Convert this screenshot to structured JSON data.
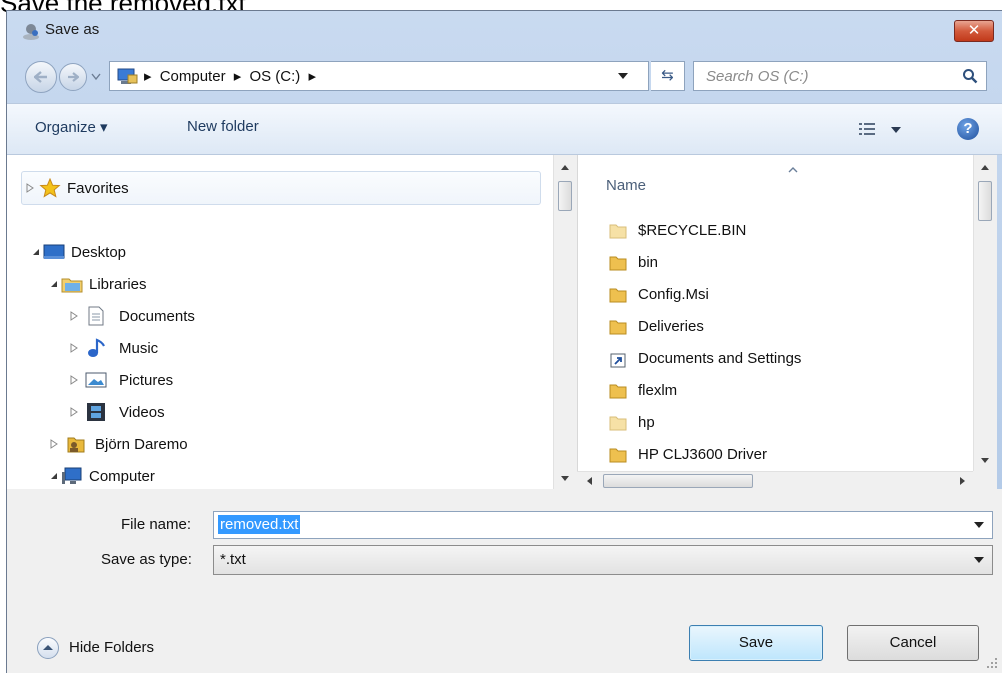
{
  "caption": "Save the removed.txt",
  "window": {
    "title": "Save as",
    "close_label": "✕"
  },
  "nav": {
    "breadcrumbs": [
      "Computer",
      "OS (C:)"
    ],
    "search_placeholder": "Search OS (C:)"
  },
  "toolbar": {
    "organize_label": "Organize ▾",
    "new_folder_label": "New folder",
    "help_label": "?"
  },
  "tree": {
    "items": [
      {
        "label": "Favorites",
        "icon": "star-icon",
        "level": 0,
        "expanded": false
      },
      {
        "label": "Desktop",
        "icon": "desktop-icon",
        "level": 0,
        "expanded": true
      },
      {
        "label": "Libraries",
        "icon": "libraries-icon",
        "level": 1,
        "expanded": true
      },
      {
        "label": "Documents",
        "icon": "documents-icon",
        "level": 2,
        "expanded": false
      },
      {
        "label": "Music",
        "icon": "music-icon",
        "level": 2,
        "expanded": false
      },
      {
        "label": "Pictures",
        "icon": "pictures-icon",
        "level": 2,
        "expanded": false
      },
      {
        "label": "Videos",
        "icon": "videos-icon",
        "level": 2,
        "expanded": false
      },
      {
        "label": "Björn Daremo",
        "icon": "user-folder-icon",
        "level": 1,
        "expanded": false
      },
      {
        "label": "Computer",
        "icon": "computer-icon",
        "level": 1,
        "expanded": true
      }
    ]
  },
  "file_list": {
    "column_header": "Name",
    "items": [
      {
        "label": "$RECYCLE.BIN",
        "icon": "folder-faded-icon"
      },
      {
        "label": "bin",
        "icon": "folder-icon"
      },
      {
        "label": "Config.Msi",
        "icon": "folder-icon"
      },
      {
        "label": "Deliveries",
        "icon": "folder-icon"
      },
      {
        "label": "Documents and Settings",
        "icon": "shortcut-icon"
      },
      {
        "label": "flexlm",
        "icon": "folder-icon"
      },
      {
        "label": "hp",
        "icon": "folder-faded-icon"
      },
      {
        "label": "HP CLJ3600 Driver",
        "icon": "folder-icon"
      }
    ]
  },
  "form": {
    "file_name_label": "File name:",
    "file_name_value": "removed.txt",
    "save_type_label": "Save as type:",
    "save_type_value": "*.txt"
  },
  "footer": {
    "hide_folders_label": "Hide Folders",
    "save_label": "Save",
    "cancel_label": "Cancel"
  },
  "colors": {
    "selection": "#3399ff",
    "close_button": "#c1391a",
    "folder": "#e8b84a"
  }
}
